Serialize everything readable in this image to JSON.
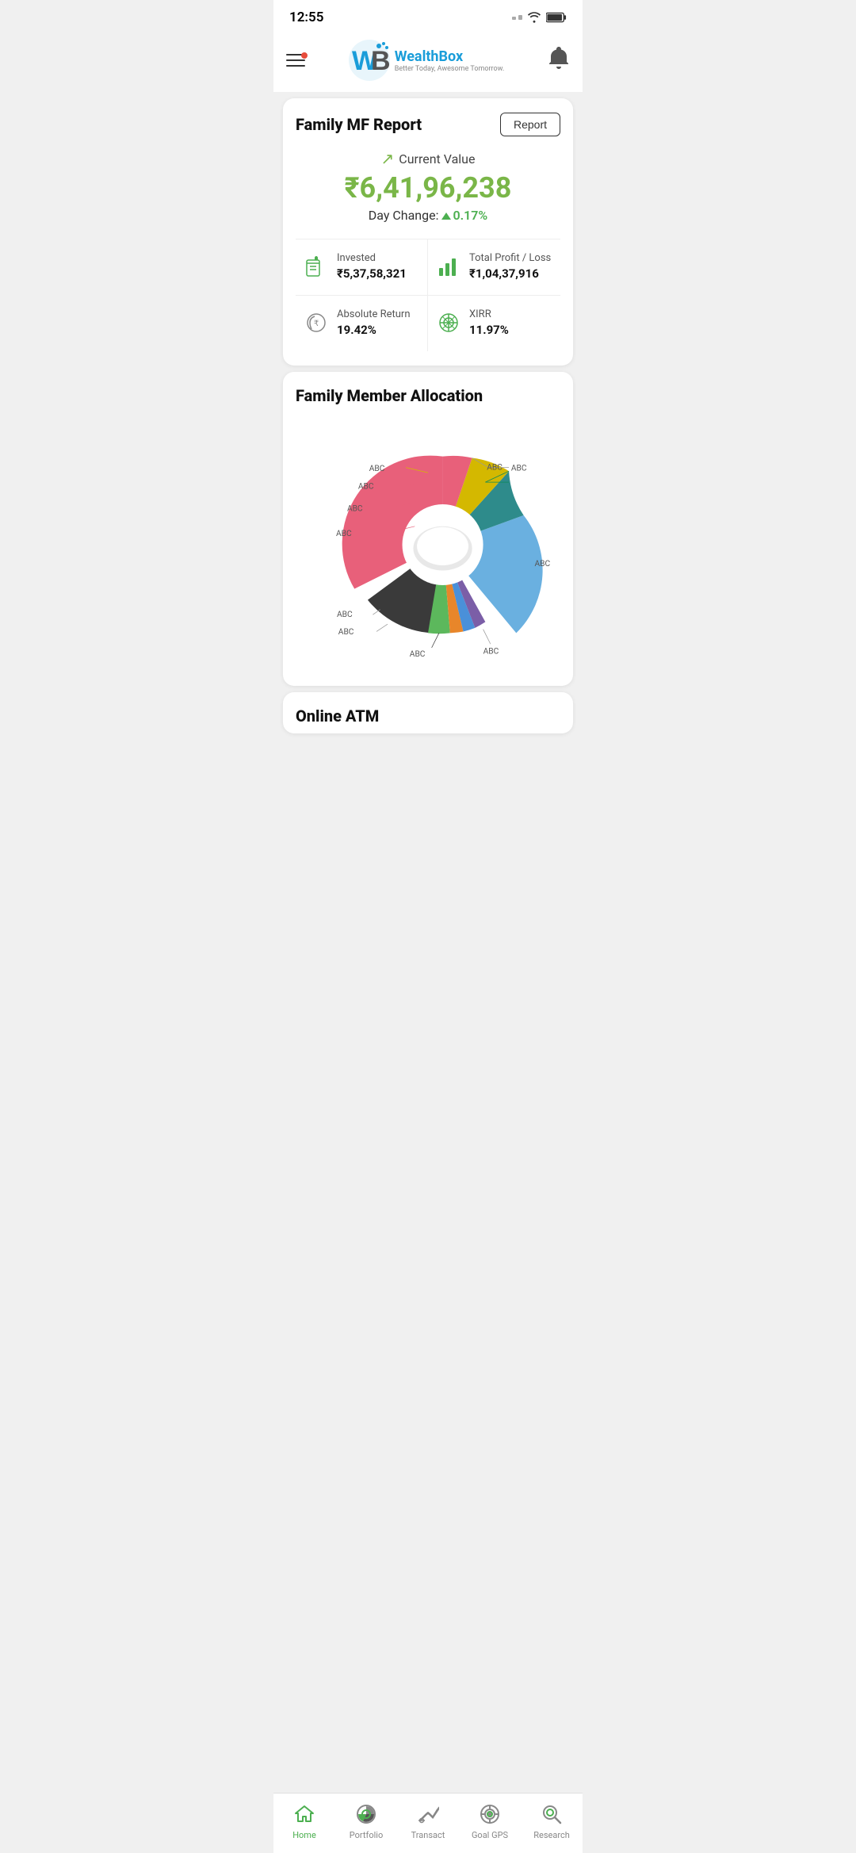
{
  "statusBar": {
    "time": "12:55"
  },
  "header": {
    "logo_w": "W",
    "logo_b": "B",
    "brand_wealth": "Wealth",
    "brand_box": "Box",
    "tagline": "Better Today, Awesome Tomorrow."
  },
  "mfReport": {
    "title": "Family MF Report",
    "report_btn": "Report",
    "current_value_label": "Current Value",
    "current_value": "₹6,41,96,238",
    "day_change_label": "Day Change:",
    "day_change_value": "0.17%",
    "invested_label": "Invested",
    "invested_value": "₹5,37,58,321",
    "profit_loss_label": "Total Profit / Loss",
    "profit_loss_value": "₹1,04,37,916",
    "abs_return_label": "Absolute Return",
    "abs_return_value": "19.42%",
    "xirr_label": "XIRR",
    "xirr_value": "11.97%"
  },
  "allocation": {
    "title": "Family Member Allocation",
    "labels": [
      "ABC",
      "ABC",
      "ABC",
      "ABC",
      "ABC",
      "ABC",
      "ABC",
      "ABC",
      "ABC",
      "ABC"
    ]
  },
  "bottomNav": {
    "home_label": "Home",
    "portfolio_label": "Portfolio",
    "transact_label": "Transact",
    "goal_gps_label": "Goal GPS",
    "research_label": "Research"
  },
  "onlineAtm": {
    "title": "Online ATM"
  }
}
